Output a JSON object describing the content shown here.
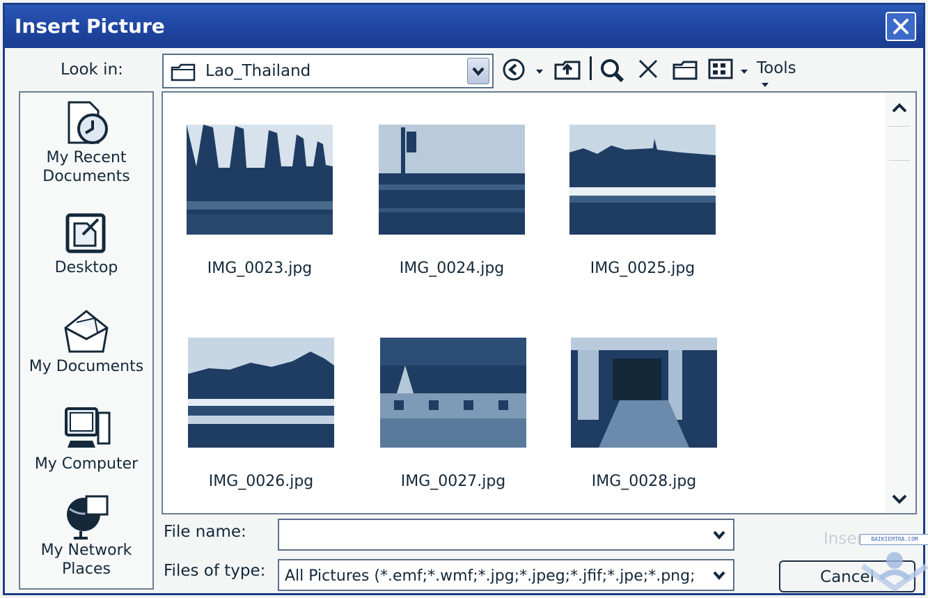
{
  "window": {
    "title": "Insert Picture"
  },
  "lookin": {
    "label": "Look in:",
    "value": "Lao_Thailand"
  },
  "toolbar": {
    "tools_label": "Tools"
  },
  "places": [
    {
      "label_line1": "My Recent",
      "label_line2": "Documents",
      "icon": "recent-documents-icon"
    },
    {
      "label_line1": "Desktop",
      "label_line2": "",
      "icon": "desktop-icon"
    },
    {
      "label_line1": "My Documents",
      "label_line2": "",
      "icon": "my-documents-icon"
    },
    {
      "label_line1": "My Computer",
      "label_line2": "",
      "icon": "my-computer-icon"
    },
    {
      "label_line1": "My Network",
      "label_line2": "Places",
      "icon": "network-places-icon"
    }
  ],
  "files": [
    {
      "name": "IMG_0023.jpg"
    },
    {
      "name": "IMG_0024.jpg"
    },
    {
      "name": "IMG_0025.jpg"
    },
    {
      "name": "IMG_0026.jpg"
    },
    {
      "name": "IMG_0027.jpg"
    },
    {
      "name": "IMG_0028.jpg"
    }
  ],
  "filename": {
    "label": "File name:",
    "value": ""
  },
  "filetype": {
    "label": "Files of type:",
    "value": "All Pictures (*.emf;*.wmf;*.jpg;*.jpeg;*.jfif;*.jpe;*.png;"
  },
  "buttons": {
    "insert": "Inser",
    "cancel": "Cancel"
  },
  "watermark": {
    "text": "BAIKIEMTRA.COM"
  },
  "colors": {
    "titlebar": "#1e45a0",
    "thumbnail_tone": "#1f3c63",
    "text": "#14283a"
  }
}
